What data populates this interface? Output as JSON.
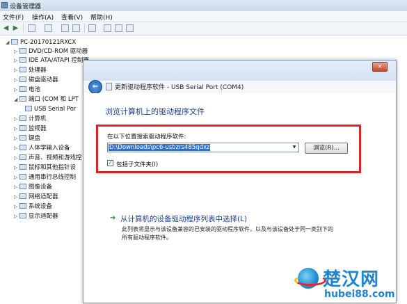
{
  "window": {
    "title": "设备管理器"
  },
  "menu": [
    "文件(F)",
    "操作(A)",
    "查看(V)",
    "帮助(H)"
  ],
  "tree": {
    "root": "PC-20170121RXCX",
    "items": [
      "DVD/CD-ROM 驱动器",
      "IDE ATA/ATAPI 控制器",
      "处理器",
      "磁盘驱动器",
      "电池",
      "端口 (COM 和 LPT",
      "USB Serial Por",
      "计算机",
      "监视器",
      "键盘",
      "人体学输入设备",
      "声音、视频和游戏控",
      "鼠标和其他指针设",
      "通用串行总线控制",
      "图像设备",
      "网络适配器",
      "系统设备",
      "显示适配器"
    ]
  },
  "dialog": {
    "title": "更新驱动程序软件 - USB Serial Port (COM4)",
    "heading": "浏览计算机上的驱动程序文件",
    "search_label": "在以下位置搜索驱动程序软件:",
    "path_value": "D:\\Downloads\\pc6-usbzrs485qdxz",
    "browse_label": "浏览(R)...",
    "include_subfolders_label": "包括子文件夹(I)",
    "include_subfolders_checked": true,
    "pick_title": "从计算机的设备驱动程序列表中选择(L)",
    "pick_desc_1": "此列表将显示与该设备兼容的已安装的驱动程序软件，以及与该设备处于同一类别下的",
    "pick_desc_2": "所有驱动程序软件。"
  },
  "watermark": {
    "brand": "楚汉网",
    "url": "hubei88.com"
  }
}
